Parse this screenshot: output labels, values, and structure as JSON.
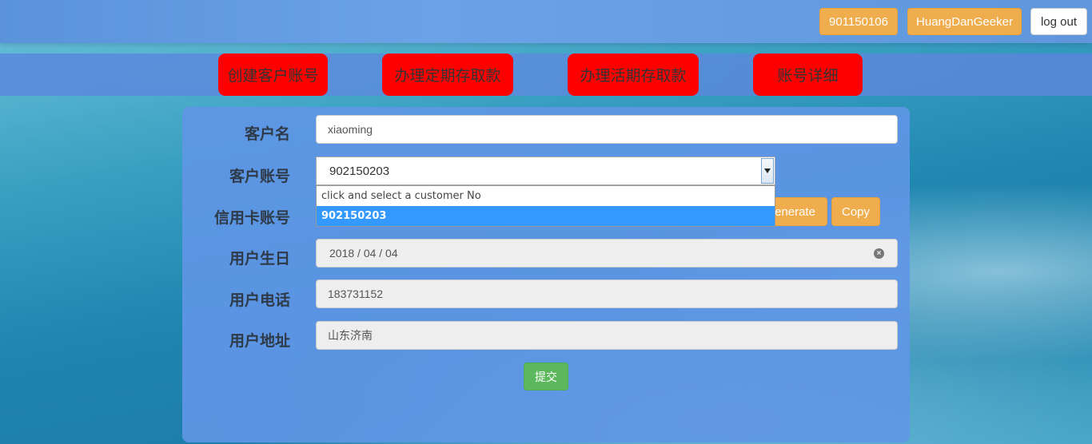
{
  "header": {
    "account_no": "901150106",
    "username": "HuangDanGeeker",
    "logout_label": "log out"
  },
  "nav": {
    "items": [
      {
        "label": "创建客户账号"
      },
      {
        "label": "办理定期存取款"
      },
      {
        "label": "办理活期存取款"
      },
      {
        "label": "账号详细"
      }
    ]
  },
  "form": {
    "customer_name": {
      "label": "客户名",
      "value": "xiaoming"
    },
    "customer_account": {
      "label": "客户账号",
      "value": "902150203",
      "options": [
        "click and select a customer No",
        "902150203"
      ]
    },
    "credit_card": {
      "label": "信用卡账号",
      "generate_label": "Generate",
      "copy_label": "Copy"
    },
    "birthday": {
      "label": "用户生日",
      "value": "2018 / 04 / 04"
    },
    "phone": {
      "label": "用户电话",
      "value": "183731152"
    },
    "address": {
      "label": "用户地址",
      "value": "山东济南"
    },
    "submit_label": "提交"
  },
  "colors": {
    "accent_orange": "#f0ad4e",
    "nav_red": "#ff0000",
    "submit_green": "#5cb85c",
    "selected_option": "#3399ff"
  }
}
